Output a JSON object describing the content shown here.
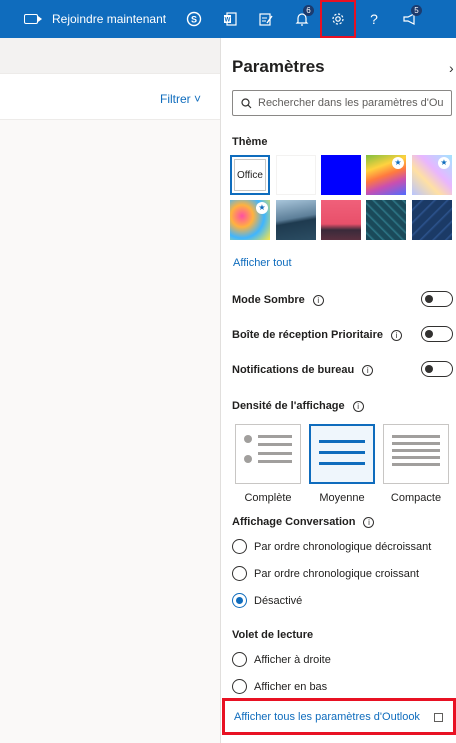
{
  "topbar": {
    "meet_label": "Rejoindre maintenant",
    "notifications_badge": "6",
    "feedback_badge": "5",
    "help_label": "?"
  },
  "mail": {
    "filter_label": "Filtrer"
  },
  "settings": {
    "title": "Paramètres",
    "search_placeholder": "Rechercher dans les paramètres d'Ou",
    "theme_heading": "Thème",
    "office_theme_label": "Office",
    "show_all_link": "Afficher tout",
    "dark_mode_label": "Mode Sombre",
    "focused_inbox_label": "Boîte de réception Prioritaire",
    "desktop_notifications_label": "Notifications de bureau",
    "density_heading": "Densité de l'affichage",
    "density_options": [
      "Complète",
      "Moyenne",
      "Compacte"
    ],
    "density_selected": "Moyenne",
    "conversation_heading": "Affichage Conversation",
    "conversation_options": [
      "Par ordre chronologique décroissant",
      "Par ordre chronologique croissant",
      "Désactivé"
    ],
    "conversation_selected": "Désactivé",
    "reading_pane_heading": "Volet de lecture",
    "reading_pane_options": [
      "Afficher à droite",
      "Afficher en bas"
    ],
    "all_settings_link": "Afficher tous les paramètres d'Outlook"
  },
  "colors": {
    "brand": "#0f6cbd",
    "highlight": "#e81123"
  }
}
